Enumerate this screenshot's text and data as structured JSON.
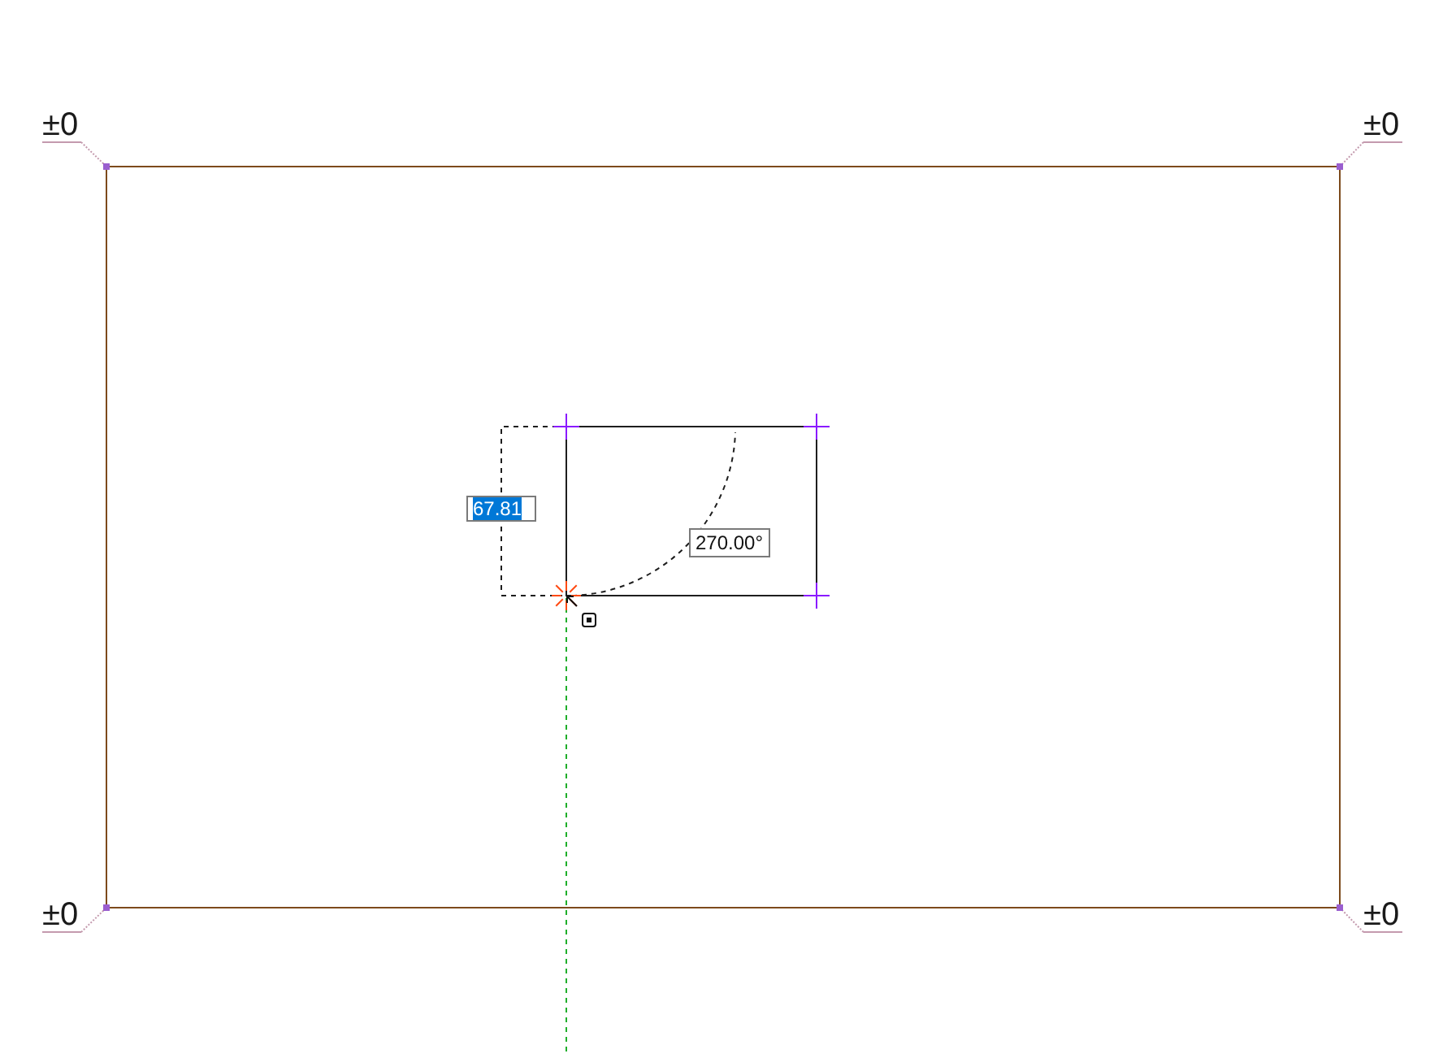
{
  "canvas": {
    "elevation_labels": [
      {
        "text": "±0"
      },
      {
        "text": "±0"
      },
      {
        "text": "±0"
      },
      {
        "text": "±0"
      }
    ],
    "length_input": {
      "value": "67.81",
      "text_selected": true
    },
    "angle_readout": {
      "text": "270.00°"
    }
  }
}
